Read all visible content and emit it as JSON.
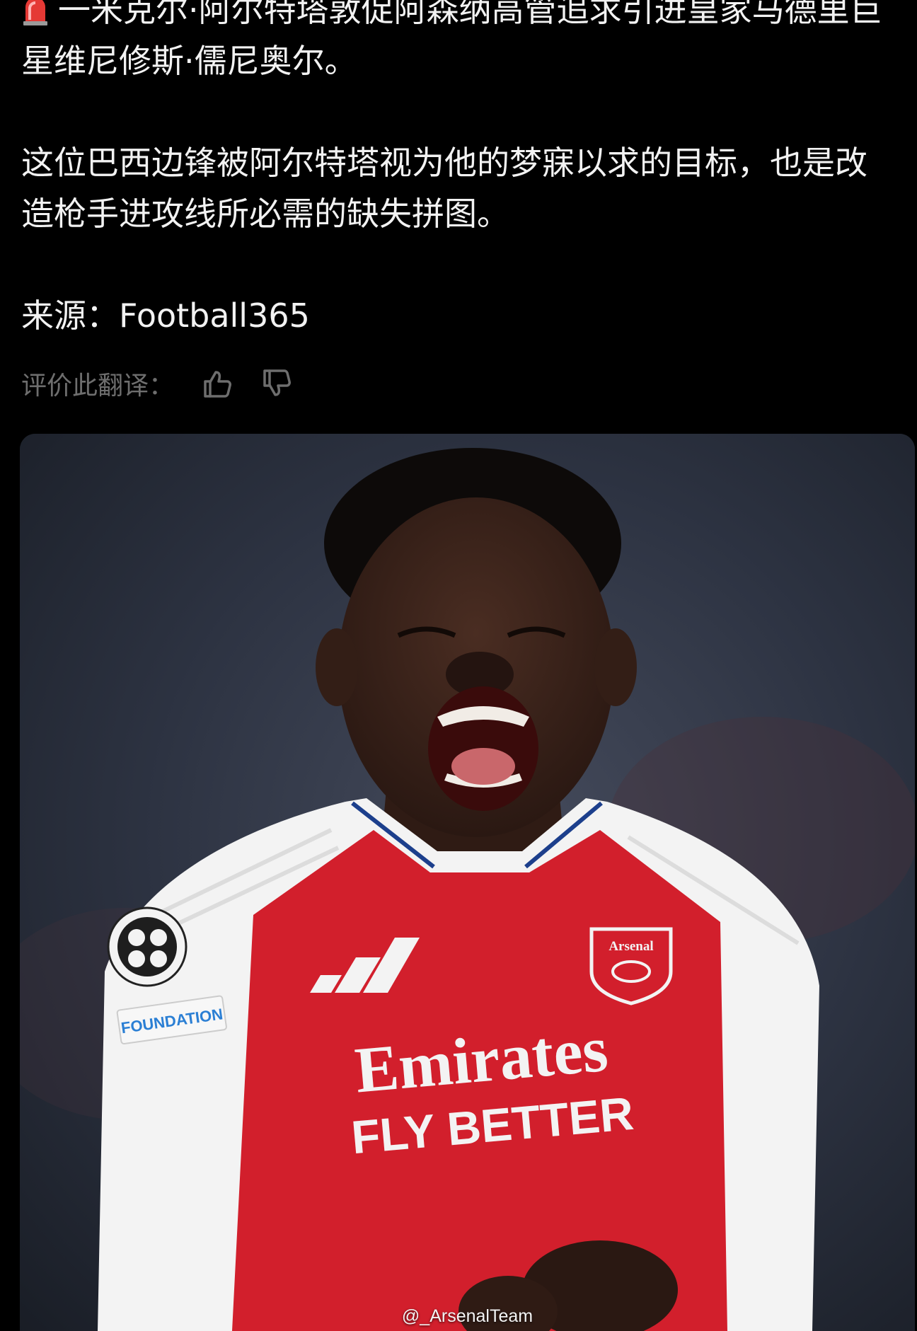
{
  "post": {
    "paragraph_1": "一米克尔·阿尔特塔敦促阿森纳高管追求引进皇家马德里巨星维尼修斯·儒尼奥尔。",
    "paragraph_2": "这位巴西边锋被阿尔特塔视为他的梦寐以求的目标，也是改造枪手进攻线所必需的缺失拼图。",
    "source_label": "来源：",
    "source_value": "Football365",
    "siren_icon": "police-siren-emoji"
  },
  "translation_feedback": {
    "label": "评价此翻译：",
    "thumbs_up_icon": "thumbs-up-icon",
    "thumbs_down_icon": "thumbs-down-icon"
  },
  "media": {
    "kit_brand": "Emirates",
    "kit_slogan": "FLY BETTER",
    "club_badge_text": "Arsenal",
    "sleeve_patch_text": "FOUNDATION",
    "watermark": "@_ArsenalTeam"
  },
  "colors": {
    "background": "#000000",
    "text": "#f2f2f2",
    "muted_text": "#6e6e6e",
    "jersey_red": "#d21f2c",
    "jersey_white": "#f3f3f3"
  }
}
